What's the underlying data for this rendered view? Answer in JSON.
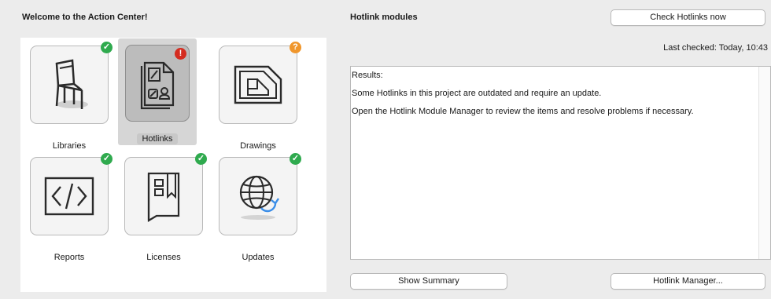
{
  "left_panel": {
    "title": "Welcome to the Action Center!",
    "tiles": [
      {
        "label": "Libraries",
        "status": "ok",
        "badge_glyph": "✓",
        "icon": "chair-icon"
      },
      {
        "label": "Hotlinks",
        "status": "error",
        "badge_glyph": "!",
        "icon": "hotlink-document-icon"
      },
      {
        "label": "Drawings",
        "status": "warning",
        "badge_glyph": "?",
        "icon": "drawing-sheet-icon"
      },
      {
        "label": "Reports",
        "status": "ok",
        "badge_glyph": "✓",
        "icon": "code-report-icon"
      },
      {
        "label": "Licenses",
        "status": "ok",
        "badge_glyph": "✓",
        "icon": "license-book-icon"
      },
      {
        "label": "Updates",
        "status": "ok",
        "badge_glyph": "✓",
        "icon": "globe-update-icon"
      }
    ]
  },
  "right_panel": {
    "title": "Hotlink modules",
    "check_button": "Check Hotlinks now",
    "last_checked": "Last checked: Today, 10:43",
    "results": {
      "heading": "Results:",
      "line1": "Some Hotlinks in this project are outdated and require an update.",
      "line2": "Open the Hotlink Module Manager to review the items and resolve problems if necessary."
    },
    "summary_button": "Show Summary",
    "manager_button": "Hotlink Manager..."
  },
  "colors": {
    "ok": "#2faa4e",
    "error": "#d42c20",
    "warning": "#f0962b",
    "accent_blue": "#3b8ee8"
  }
}
